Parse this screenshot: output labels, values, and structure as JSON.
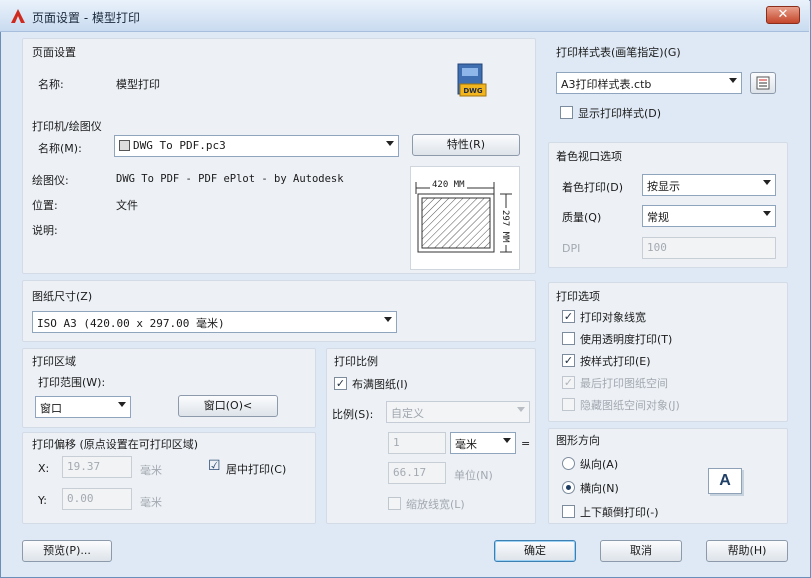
{
  "window": {
    "title": "页面设置 - 模型打印",
    "close_symbol": "✕"
  },
  "page_setup": {
    "section": "页面设置",
    "name_label": "名称:",
    "name_value": "模型打印",
    "logo_text": "DWG"
  },
  "printer": {
    "section": "打印机/绘图仪",
    "name_label": "名称(M):",
    "name_value": "DWG To PDF.pc3",
    "properties_button": "特性(R)",
    "plotter_label": "绘图仪:",
    "plotter_value": "DWG To PDF - PDF ePlot - by Autodesk",
    "location_label": "位置:",
    "location_value": "文件",
    "description_label": "说明:",
    "preview_width": "420 MM",
    "preview_height": "297 MM"
  },
  "paper_size": {
    "section": "图纸尺寸(Z)",
    "value": "ISO A3 (420.00 x 297.00 毫米)"
  },
  "plot_area": {
    "section": "打印区域",
    "range_label": "打印范围(W):",
    "range_value": "窗口",
    "window_button": "窗口(O)<"
  },
  "plot_offset": {
    "section": "打印偏移 (原点设置在可打印区域)",
    "x_label": "X:",
    "x_value": "19.37",
    "x_unit": "毫米",
    "y_label": "Y:",
    "y_value": "0.00",
    "y_unit": "毫米",
    "center_label": "居中打印(C)",
    "center_checked": "☑"
  },
  "plot_scale": {
    "section": "打印比例",
    "fit_label": "布满图纸(I)",
    "scale_label": "比例(S):",
    "scale_value": "自定义",
    "value1": "1",
    "unit_value": "毫米",
    "equals": "=",
    "value2": "66.17",
    "unit2_label": "单位(N)",
    "lineweights_label": "缩放线宽(L)"
  },
  "plot_style_table": {
    "section": "打印样式表(画笔指定)(G)",
    "value": "A3打印样式表.ctb",
    "display_label": "显示打印样式(D)"
  },
  "shaded_viewport": {
    "section": "着色视口选项",
    "shade_label": "着色打印(D)",
    "shade_value": "按显示",
    "quality_label": "质量(Q)",
    "quality_value": "常规",
    "dpi_label": "DPI",
    "dpi_value": "100"
  },
  "plot_options": {
    "section": "打印选项",
    "items": [
      {
        "label": "打印对象线宽",
        "mark": "✓"
      },
      {
        "label": "使用透明度打印(T)",
        "mark": ""
      },
      {
        "label": "按样式打印(E)",
        "mark": "✓"
      },
      {
        "label": "最后打印图纸空间",
        "mark": "✓"
      },
      {
        "label": "隐藏图纸空间对象(J)",
        "mark": ""
      }
    ]
  },
  "orientation": {
    "section": "图形方向",
    "portrait_label": "纵向(A)",
    "landscape_label": "横向(N)",
    "upside_down_label": "上下颠倒打印(-)",
    "glyph": "A"
  },
  "footer": {
    "preview_button": "预览(P)...",
    "ok_button": "确定",
    "cancel_button": "取消",
    "help_button": "帮助(H)"
  },
  "colors": {
    "accent": "#3c7fb1",
    "panel": "#edf1f6",
    "frame": "#dfe9f5"
  }
}
